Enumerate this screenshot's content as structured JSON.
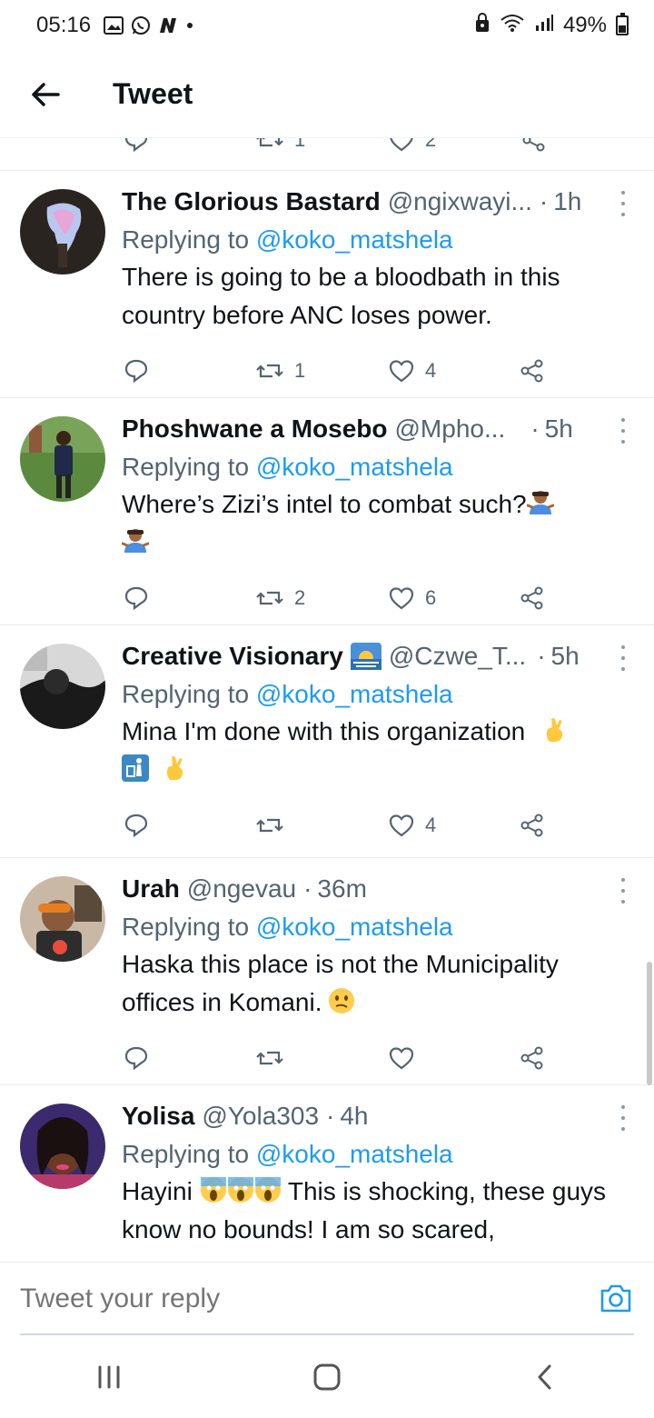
{
  "status_bar": {
    "time": "05:16",
    "battery": "49%",
    "left_icons": [
      "gallery-icon",
      "whatsapp-icon",
      "n-app-icon",
      "dot-icon"
    ],
    "right_icons": [
      "lock-icon",
      "wifi-icon",
      "signal-icon",
      "battery-icon"
    ]
  },
  "header": {
    "title": "Tweet",
    "back_icon": "arrow-left-icon"
  },
  "partial_actions": {
    "retweets": "1",
    "likes": "2"
  },
  "tweets": [
    {
      "name": "The Glorious Bastard",
      "handle": "@ngixwayi...",
      "sep": "·",
      "time": "1h",
      "replying_prefix": "Replying to",
      "replying_to": "@koko_matshela",
      "text": "There is going to be a bloodbath in this country before ANC loses power.",
      "retweets": "1",
      "likes": "4"
    },
    {
      "name": "Phoshwane a Mosebo",
      "handle": "@Mpho...",
      "sep": "·",
      "time": "5h",
      "replying_prefix": "Replying to",
      "replying_to": "@koko_matshela",
      "text": "Where’s Zizi’s intel to combat such?",
      "retweets": "2",
      "likes": "6"
    },
    {
      "name": "Creative Visionary",
      "handle": "@Czwe_T...",
      "sep": "·",
      "time": "5h",
      "replying_prefix": "Replying to",
      "replying_to": "@koko_matshela",
      "text": "Mina I'm done with this organization",
      "retweets": "",
      "likes": "4"
    },
    {
      "name": "Urah",
      "handle": "@ngevau",
      "sep": "·",
      "time": "36m",
      "replying_prefix": "Replying to",
      "replying_to": "@koko_matshela",
      "text_line1": "Haska this place is not the Municipality",
      "text_line2": "offices in Komani.",
      "retweets": "",
      "likes": ""
    },
    {
      "name": "Yolisa",
      "handle": "@Yola303",
      "sep": "·",
      "time": "4h",
      "replying_prefix": "Replying to",
      "replying_to": "@koko_matshela",
      "text_pre": "Hayini",
      "text_post": "This is shocking, these guys know no bounds! I am so scared,"
    }
  ],
  "reply_bar": {
    "placeholder": "Tweet your reply",
    "camera_icon": "camera-icon"
  },
  "nav_bar": {
    "icons": [
      "recent-apps-icon",
      "home-icon",
      "back-icon"
    ]
  },
  "colors": {
    "accent": "#1d9bf0",
    "text_primary": "#0f1419",
    "text_secondary": "#536471",
    "divider": "#e6ecf0"
  }
}
